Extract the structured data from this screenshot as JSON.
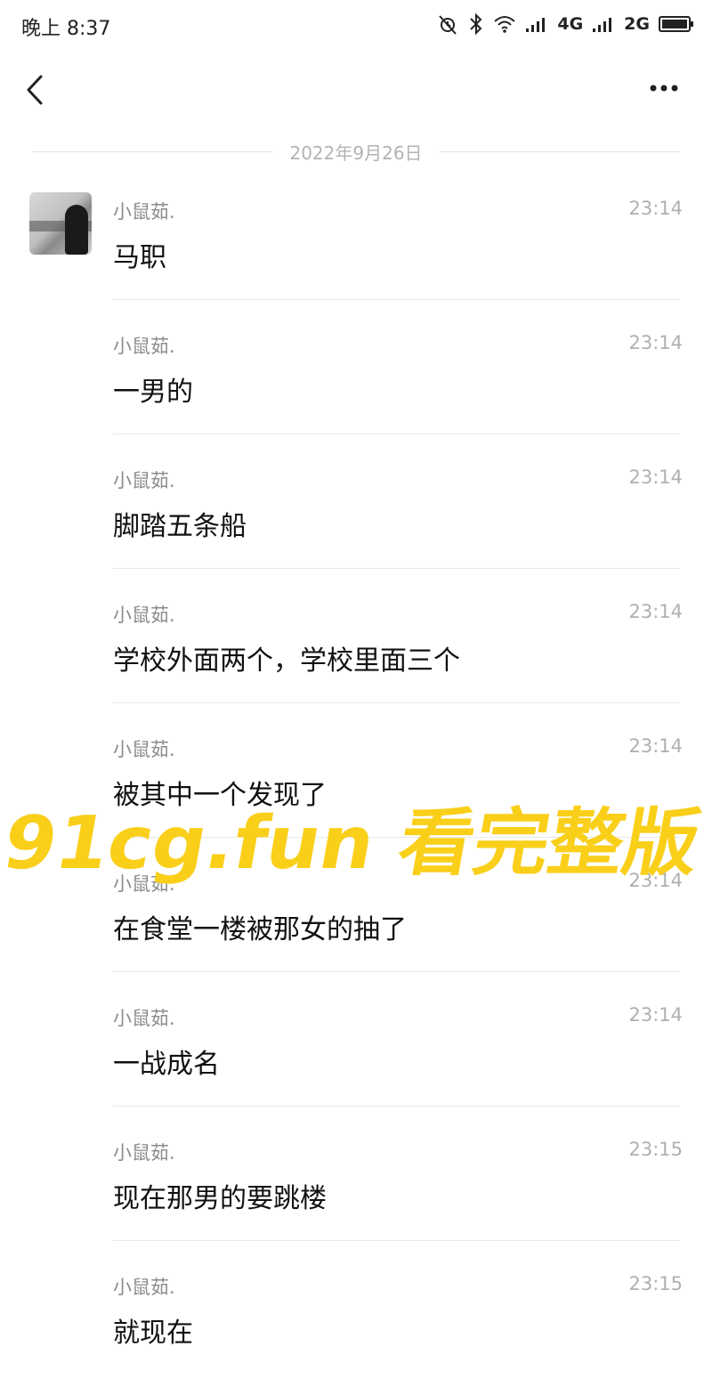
{
  "status_bar": {
    "time": "晚上 8:37",
    "network_1": "4G",
    "network_2": "2G"
  },
  "header": {
    "back_icon": "chevron-left-icon",
    "more_icon": "more-dots-icon"
  },
  "date_divider": "2022年9月26日",
  "messages": [
    {
      "sender": "小鼠茹.",
      "time": "23:14",
      "text": "马职"
    },
    {
      "sender": "小鼠茹.",
      "time": "23:14",
      "text": "一男的"
    },
    {
      "sender": "小鼠茹.",
      "time": "23:14",
      "text": "脚踏五条船"
    },
    {
      "sender": "小鼠茹.",
      "time": "23:14",
      "text": "学校外面两个，学校里面三个"
    },
    {
      "sender": "小鼠茹.",
      "time": "23:14",
      "text": "被其中一个发现了"
    },
    {
      "sender": "小鼠茹.",
      "time": "23:14",
      "text": "在食堂一楼被那女的抽了"
    },
    {
      "sender": "小鼠茹.",
      "time": "23:14",
      "text": "一战成名"
    },
    {
      "sender": "小鼠茹.",
      "time": "23:15",
      "text": "现在那男的要跳楼"
    },
    {
      "sender": "小鼠茹.",
      "time": "23:15",
      "text": "就现在"
    }
  ],
  "watermark": {
    "text": "91cg.fun 看完整版",
    "color": "#f9cf1a"
  }
}
